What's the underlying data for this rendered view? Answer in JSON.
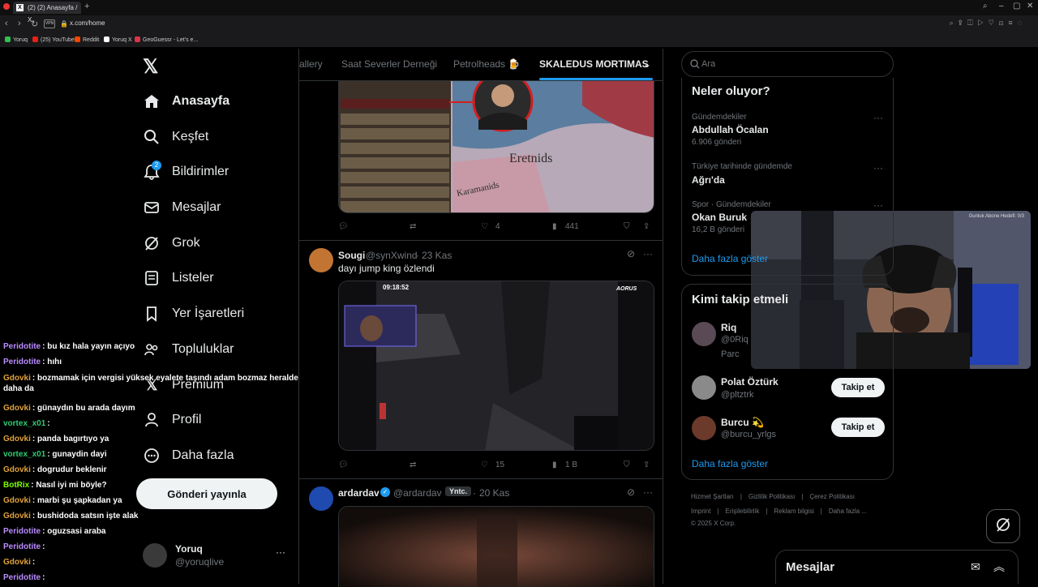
{
  "browser": {
    "tab_title": "(2) (2) Anasayfa / X",
    "url": "x.com/home",
    "vpn_label": "VPN",
    "bookmarks": [
      {
        "label": "Yoruq",
        "color": "#31c24f"
      },
      {
        "label": "(25) YouTube",
        "color": "#e62117"
      },
      {
        "label": "Reddit",
        "color": "#ff4500"
      },
      {
        "label": "Yoruq X",
        "color": "#ffffff"
      },
      {
        "label": "GeoGuessr - Let's e...",
        "color": "#d9354a"
      }
    ]
  },
  "nav": {
    "items": [
      {
        "label": "Anasayfa",
        "icon": "home-icon"
      },
      {
        "label": "Keşfet",
        "icon": "search-icon"
      },
      {
        "label": "Bildirimler",
        "icon": "bell-icon",
        "badge": "2"
      },
      {
        "label": "Mesajlar",
        "icon": "mail-icon"
      },
      {
        "label": "Grok",
        "icon": "grok-icon"
      },
      {
        "label": "Listeler",
        "icon": "list-icon"
      },
      {
        "label": "Yer İşaretleri",
        "icon": "bookmark-icon"
      },
      {
        "label": "Topluluklar",
        "icon": "communities-icon"
      },
      {
        "label": "Premium",
        "icon": "x-premium-icon"
      },
      {
        "label": "Profil",
        "icon": "profile-icon"
      },
      {
        "label": "Daha fazla",
        "icon": "more-circle-icon"
      }
    ],
    "post_button": "Gönderi yayınla",
    "account": {
      "name": "Yoruq",
      "handle": "@yoruqlive",
      "more": "···"
    }
  },
  "chat": [
    {
      "user": "Peridotite",
      "color": "#b98cff",
      "text": "bu kız hala yayın açıyo"
    },
    {
      "user": "Peridotite",
      "color": "#b98cff",
      "text": "hıhı"
    },
    {
      "user": "Gdovki",
      "color": "#e0a23a",
      "text": "bozmamak için vergisi yüksek eyalete taşındı adam bozmaz heralde daha da"
    },
    {
      "user": "Gdovki",
      "color": "#e0a23a",
      "text": "günaydın bu arada dayım"
    },
    {
      "user": "vortex_x01",
      "color": "#2ecc71",
      "text": ""
    },
    {
      "user": "Gdovki",
      "color": "#e0a23a",
      "text": "panda bagırtıyo ya"
    },
    {
      "user": "vortex_x01",
      "color": "#2ecc71",
      "text": "gunaydin dayi"
    },
    {
      "user": "Gdovki",
      "color": "#e0a23a",
      "text": "dogrudur beklenir"
    },
    {
      "user": "BotRix",
      "color": "#7cfc00",
      "text": "Nasıl iyi mi böyle?"
    },
    {
      "user": "Gdovki",
      "color": "#e0a23a",
      "text": "marbi şu şapkadan ya"
    },
    {
      "user": "Gdovki",
      "color": "#e0a23a",
      "text": "bushidoda satsın işte alak"
    },
    {
      "user": "Peridotite",
      "color": "#b98cff",
      "text": "oguzsasi araba"
    },
    {
      "user": "Peridotite",
      "color": "#b98cff",
      "text": ""
    },
    {
      "user": "Gdovki",
      "color": "#e0a23a",
      "text": ""
    },
    {
      "user": "Peridotite",
      "color": "#b98cff",
      "text": ""
    }
  ],
  "timeline": {
    "tabs": [
      "allery",
      "Saat Severler Derneği",
      "Petrolheads 🍺",
      "SKALEDUS MORTIMAS"
    ],
    "tweet1": {
      "likes": "4",
      "views": "441",
      "map_label": "Eretnids",
      "map_label2": "Karamanids"
    },
    "tweet2": {
      "name": "Sougi",
      "handle": "@synXwind",
      "date": "23 Kas",
      "text": "dayı jump king özlendi",
      "timer": "09:18:52",
      "likes": "15",
      "views": "1 B",
      "brand": "AORUS"
    },
    "tweet3": {
      "name": "ardardav",
      "handle": "@ardardav",
      "tag": "Yntc.",
      "date": "20 Kas"
    }
  },
  "right": {
    "search_placeholder": "Ara",
    "trends_title": "Neler oluyor?",
    "trends": [
      {
        "context": "Gündemdekiler",
        "name": "Abdullah Öcalan",
        "count": "6.906 gönderi"
      },
      {
        "context": "Türkiye tarihinde gündemde",
        "name": "Ağrı'da",
        "count": ""
      },
      {
        "context": "Spor · Gündemdekiler",
        "name": "Okan Buruk",
        "count": "16,2 B gönderi"
      }
    ],
    "show_more": "Daha fazla göster",
    "who_title": "Kimi takip etmeli",
    "who": [
      {
        "name": "Riq",
        "handle": "@0Riq",
        "extra": "Parc"
      },
      {
        "name": "Polat Öztürk",
        "handle": "@pltztrk",
        "button": "Takip et"
      },
      {
        "name": "Burcu 💫",
        "handle": "@burcu_yrlgs",
        "button": "Takip et"
      }
    ],
    "who_show_more": "Daha fazla göster",
    "footer_line1": [
      "Hizmet Şartları",
      "Gizlilik Politikası",
      "Çerez Politikası"
    ],
    "footer_line2": [
      "Imprint",
      "Erişilebilirlik",
      "Reklam bilgisi",
      "Daha fazla ..."
    ],
    "copyright": "© 2025 X Corp."
  },
  "messages_drawer": {
    "title": "Mesajlar"
  },
  "webcam": {
    "overlay_text": "Gunluk Abone Hedefi: 0/3"
  }
}
